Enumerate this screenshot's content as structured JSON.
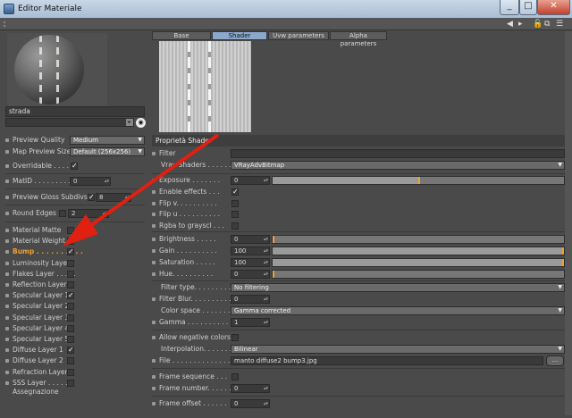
{
  "window": {
    "title": "Editor Materiale"
  },
  "toolbar": {
    "icons": [
      "arrow-left-icon",
      "arrow-right-icon",
      "unlock-icon",
      "new-window-icon",
      "menu-icon"
    ]
  },
  "left": {
    "material_name": "strada",
    "rows": [
      {
        "label": "Preview Quality",
        "value": "Medium"
      },
      {
        "label": "Map Preview Size",
        "value": "Default (256x256)"
      },
      {
        "label": "Overridable . . . . .",
        "checked": true
      },
      {
        "label": "MatID . . . . . . . . .",
        "value": "0"
      },
      {
        "label": "Preview Gloss Subdivs",
        "value": "8"
      },
      {
        "label": "Round Edges . .",
        "value": "2"
      }
    ],
    "layers": [
      {
        "label": "Material Matte",
        "checked": false
      },
      {
        "label": "Material Weight",
        "checked": false
      },
      {
        "label": "Bump . . . . . . . . . .",
        "checked": true,
        "selected": true
      },
      {
        "label": "Luminosity Layer",
        "checked": false
      },
      {
        "label": "Flakes Layer . . . . .",
        "checked": false
      },
      {
        "label": "Reflection Layer",
        "checked": false
      },
      {
        "label": "Specular Layer 1",
        "checked": true
      },
      {
        "label": "Specular Layer 2",
        "checked": false
      },
      {
        "label": "Specular Layer 3",
        "checked": false
      },
      {
        "label": "Specular Layer 4",
        "checked": false
      },
      {
        "label": "Specular Layer 5",
        "checked": false
      },
      {
        "label": "Diffuse Layer 1",
        "checked": true
      },
      {
        "label": "Diffuse Layer 2",
        "checked": false
      },
      {
        "label": "Refraction Layer",
        "checked": false
      },
      {
        "label": "SSS Layer . . . . . .",
        "checked": false
      }
    ],
    "assignment": "Assegnazione"
  },
  "tabs": [
    {
      "label": "Base",
      "active": false
    },
    {
      "label": "Shader",
      "active": true
    },
    {
      "label": "Uvw parameters",
      "active": false
    },
    {
      "label": "Alpha parameters",
      "active": false
    }
  ],
  "props": {
    "header": "Proprietà Shader",
    "filter_label": "Filter",
    "vray_shaders_label": "Vray Shaders . . . . . . . .",
    "vray_shaders_value": "VRayAdvBitmap",
    "exposure": {
      "label": "Exposure . . . . . . .",
      "value": "0",
      "fraction": 0.5
    },
    "checks": [
      {
        "label": "Enable effects . . .",
        "checked": true
      },
      {
        "label": "Flip v. . . . . . . . . .",
        "checked": false
      },
      {
        "label": "Flip u . . . . . . . . . .",
        "checked": false
      },
      {
        "label": "Rgba to grayscl . . .",
        "checked": false
      }
    ],
    "sliders": [
      {
        "label": "Brightness . . . . .",
        "value": "0",
        "fraction": 0.0
      },
      {
        "label": "Gain . . . . . . . . . .",
        "value": "100",
        "fraction": 1.0
      },
      {
        "label": "Saturation . . . . .",
        "value": "100",
        "fraction": 1.0
      },
      {
        "label": "Hue. . . . . . . . . .",
        "value": "0",
        "fraction": 0.0
      }
    ],
    "filter_type": {
      "label": "Filter type. . . . . . . . . .",
      "value": "No filtering"
    },
    "filter_blur": {
      "label": "Filter Blur. . . . . . . . . .",
      "value": "0"
    },
    "color_space": {
      "label": "Color space . . . . . . . . .",
      "value": "Gamma corrected"
    },
    "gamma": {
      "label": "Gamma . . . . . . . . . . . .",
      "value": "1"
    },
    "allow_negative": {
      "label": "Allow negative colors",
      "checked": false
    },
    "interpolation": {
      "label": "Interpolation. . . . . . . . . .",
      "value": "Bilinear"
    },
    "file": {
      "label": "File . . . . . . . . . . . . . .",
      "value": "manto diffuse2 bump3.jpg",
      "button": "..."
    },
    "frame_sequence": {
      "label": "Frame sequence . . .",
      "checked": false
    },
    "frame_number": {
      "label": "Frame number. . . . . .",
      "value": "0"
    },
    "frame_offset": {
      "label": "Frame offset . . . . . .",
      "value": "0"
    }
  },
  "colors": {
    "accent": "#f0a030",
    "tab_active": "#8aa8cc",
    "annotation_arrow": "#e02010"
  }
}
